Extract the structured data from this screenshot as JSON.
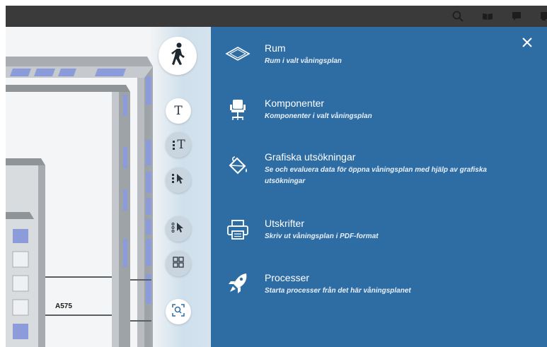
{
  "topbar": {
    "icons": [
      "search-icon",
      "book-icon",
      "comment-icon",
      "more-icon"
    ]
  },
  "viewer": {
    "room_label": "A575"
  },
  "tools": {
    "walk": "walk-icon",
    "text": "T",
    "text_list": "T",
    "select": "select-icon",
    "multi_select": "multi-select-icon",
    "grid": "grid-icon",
    "zoom": "zoom-icon"
  },
  "panel": {
    "accent": "#2e6ca4",
    "close": "×",
    "items": [
      {
        "title": "Rum",
        "subtitle": "Rum i valt våningsplan",
        "icon": "floor-plan-icon"
      },
      {
        "title": "Komponenter",
        "subtitle": "Komponenter i valt våningsplan",
        "icon": "chair-icon"
      },
      {
        "title": "Grafiska utsökningar",
        "subtitle": "Se och evaluera data för öppna våningsplan med hjälp av grafiska utsökningar",
        "icon": "paint-bucket-icon"
      },
      {
        "title": "Utskrifter",
        "subtitle": "Skriv ut våningsplan i PDF-format",
        "icon": "printer-icon"
      },
      {
        "title": "Processer",
        "subtitle": "Starta processer från det här våningsplanet",
        "icon": "rocket-icon"
      }
    ]
  }
}
